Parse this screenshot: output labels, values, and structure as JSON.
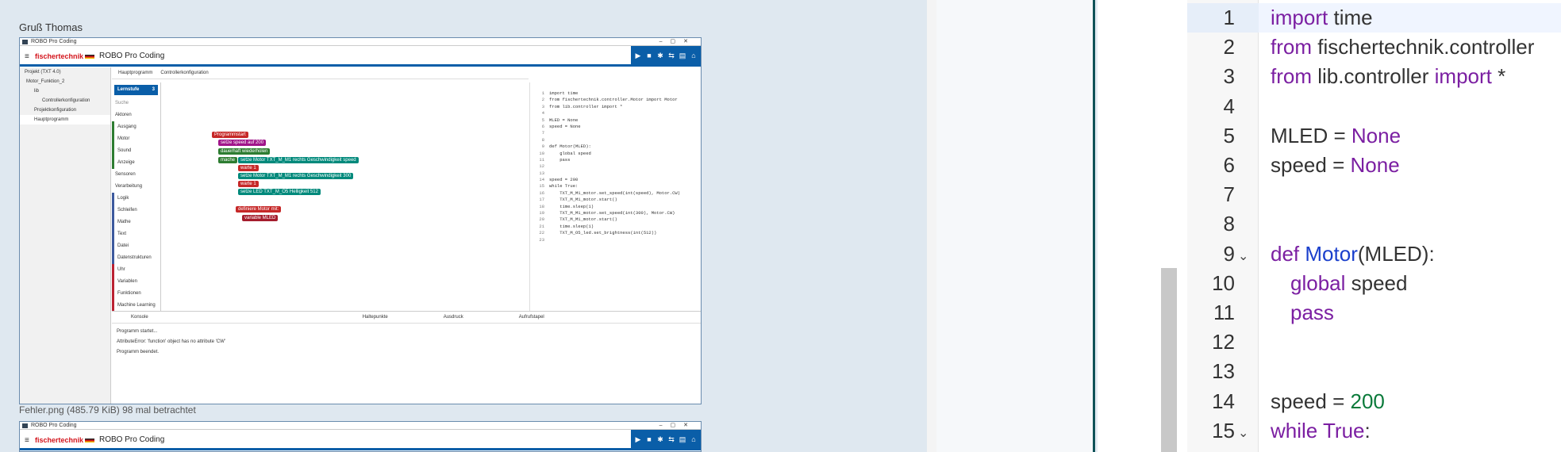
{
  "forum": {
    "greeting": "Gruß Thomas",
    "attachment_caption": "Fehler.png (485.79 KiB) 98 mal betrachtet"
  },
  "app": {
    "window_title": "ROBO Pro Coding",
    "brand": "fischertechnik",
    "title": "ROBO Pro Coding",
    "project_label": "Projekt (TXT 4.0)",
    "tree": [
      "Motor_Funktion_2",
      "lib",
      "Controllerkonfiguration",
      "Projektkonfiguration",
      "Hauptprogramm"
    ],
    "tabs": [
      "Hauptprogramm",
      "Controllerkonfiguration"
    ],
    "categories_header": "Lernstufe",
    "categories_level": "3",
    "search_placeholder": "Suche",
    "categories": [
      "Aktoren",
      "Ausgang",
      "Motor",
      "Sound",
      "Anzeige",
      "Sensoren",
      "Verarbeitung",
      "Logik",
      "Schleifen",
      "Mathe",
      "Text",
      "Datei",
      "Datenstrukturen",
      "Uhr",
      "Variablen",
      "Funktionen",
      "Machine Learning"
    ],
    "blocks": {
      "start": "Programmstart",
      "set_speed": "setze speed auf 200",
      "loop": "dauerhaft wiederholen",
      "do": "mache",
      "motor1": "setze Motor TXT_M_M1 rechts Geschwindigkeit speed",
      "wait1": "warte 1",
      "motor2": "setze Motor TXT_M_M1 rechts Geschwindigkeit 300",
      "wait2": "warte 1",
      "led": "setze LED TXT_M_O5 Helligkeit 512",
      "define": "definiere Motor mit:",
      "variable": "variable MLED"
    },
    "code_lines": [
      "import time",
      "from fischertechnik.controller.Motor import Motor",
      "from lib.controller import *",
      "",
      "MLED = None",
      "speed = None",
      "",
      "",
      "def Motor(MLED):",
      "    global speed",
      "    pass",
      "",
      "",
      "speed = 200",
      "while True:",
      "    TXT_M_M1_motor.set_speed(int(speed), Motor.CW)",
      "    TXT_M_M1_motor.start()",
      "    time.sleep(1)",
      "    TXT_M_M1_motor.set_speed(int(300), Motor.CW)",
      "    TXT_M_M1_motor.start()",
      "    time.sleep(1)",
      "    TXT_M_O5_led.set_brightness(int(512))",
      ""
    ],
    "console_tab": "Konsole",
    "console_lines": [
      "Programm startet...",
      "AttributeError: 'function' object has no attribute 'CW'",
      "Programm beendet."
    ],
    "bottom_tabs": [
      "Haltepunkte",
      "Ausdruck",
      "Aufrufstapel"
    ]
  },
  "editor": {
    "lines": [
      {
        "n": "1",
        "fold": "",
        "text": "import time"
      },
      {
        "n": "2",
        "fold": "",
        "text": "from fischertechnik.controller"
      },
      {
        "n": "3",
        "fold": "",
        "text": "from lib.controller import *"
      },
      {
        "n": "4",
        "fold": "",
        "text": ""
      },
      {
        "n": "5",
        "fold": "",
        "text": "MLED = None"
      },
      {
        "n": "6",
        "fold": "",
        "text": "speed = None"
      },
      {
        "n": "7",
        "fold": "",
        "text": ""
      },
      {
        "n": "8",
        "fold": "",
        "text": ""
      },
      {
        "n": "9",
        "fold": "v",
        "text": "def Motor(MLED):"
      },
      {
        "n": "10",
        "fold": "",
        "text": "global speed"
      },
      {
        "n": "11",
        "fold": "",
        "text": "pass"
      },
      {
        "n": "12",
        "fold": "",
        "text": ""
      },
      {
        "n": "13",
        "fold": "",
        "text": ""
      },
      {
        "n": "14",
        "fold": "",
        "text": "speed = 200"
      },
      {
        "n": "15",
        "fold": "v",
        "text": "while True:"
      }
    ]
  }
}
